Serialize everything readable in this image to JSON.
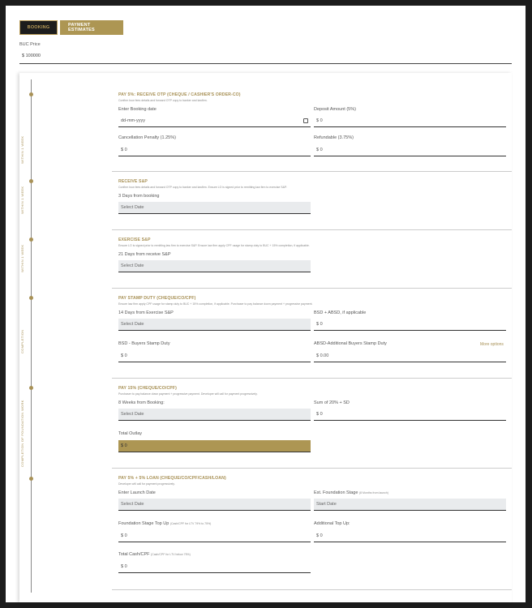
{
  "tabs": {
    "booking": "BOOKING",
    "payment": "PAYMENT ESTIMATES"
  },
  "buc": {
    "label": "BUC Price",
    "value": "$ 100000"
  },
  "timeline_labels": [
    "WITHIN 1 WEEK",
    "WITHIN 1 WEEK",
    "WITHIN 1 WEEK",
    "COMPLETION",
    "COMPLETION OF FOUNDATION WORK"
  ],
  "s1": {
    "title": "PAY 5%: RECEIVE OTP (CHEQUE / CASHIER'S ORDER-CO)",
    "desc": "Confirm how fees details and forward OTP copy to banker and lawfirm.",
    "booking_date_label": "Enter Booking date",
    "booking_date_placeholder": "dd-mm-yyyy",
    "deposit_label": "Deposit Amount (5%)",
    "deposit_value": "$ 0",
    "cancel_label": "Cancellation Penalty (1.25%)",
    "cancel_value": "$ 0",
    "refund_label": "Refundable (3.75%)",
    "refund_value": "$ 0"
  },
  "s2": {
    "title": "RECEIVE S&P",
    "desc": "Confirm how fees details and forward OTP copy to banker and lawfirm. Ensure LO is signed prior to remitting law firm to exercise S&P.",
    "days_label": "3 Days from booking",
    "date_value": "Select Date"
  },
  "s3": {
    "title": "EXERCISE S&P",
    "desc": "Ensure LO is signed prior to remitting law firm to exercise S&P. Ensure law firm apply CPF usage for stamp duty to BUC + 15% completion, if applicable.",
    "days_label": "21 Days from receive S&P",
    "date_value": "Select Date"
  },
  "s4": {
    "title": "PAY STAMP DUTY (CHEQUE/CO/CPF)",
    "desc": "Ensure law firm apply CPF usage for stamp duty to BUC + 15% completion, if applicable. Purchaser to pay balance down payment + progressive payment.",
    "days_label": "14 Days from Exercise S&P",
    "date_value": "Select Date",
    "bsd_absd_label": "BSD + ABSD, if applicable",
    "bsd_absd_value": "$ 0",
    "bsd_label": "BSD - Buyers Stamp Duty",
    "bsd_value": "$ 0",
    "absd_label": "ABSD-Additional Buyers Stamp Duty",
    "absd_value": "$ 0.00",
    "more_options": "More options"
  },
  "s5": {
    "title": "PAY 15% (CHEQUE/CO/CPF)",
    "desc": "Purchaser to pay balance down payment + progressive payment. Developer will call for payment progressively.",
    "weeks_label": "8 Weeks from Booking:",
    "date_value": "Select Date",
    "sum_label": "Sum of 20% + SD",
    "sum_value": "$ 0",
    "outlay_label": "Total Outlay",
    "outlay_value": "$ 0"
  },
  "s6": {
    "title": "PAY 5% + 5% LOAN (CHEQUE/CO/CPF/CASH/LOAN)",
    "desc": "Developer will call for payment progressively.",
    "launch_label": "Enter Launch Date",
    "launch_value": "Select Date",
    "est_label": "Est. Foundation Stage",
    "est_small": "(8 Months from launch)",
    "est_value": "Start Date",
    "topup_label": "Foundation Stage Top Up",
    "topup_small": "(Cash/CPF for LTV 79% to 75%)",
    "topup_value": "$ 0",
    "addtop_label": "Additional Top Up:",
    "addtop_value": "$ 0",
    "total_label": "Total Cash/CPF",
    "total_small": "(Cash/CPF for LTV below 75%)",
    "total_value": "$ 0"
  }
}
